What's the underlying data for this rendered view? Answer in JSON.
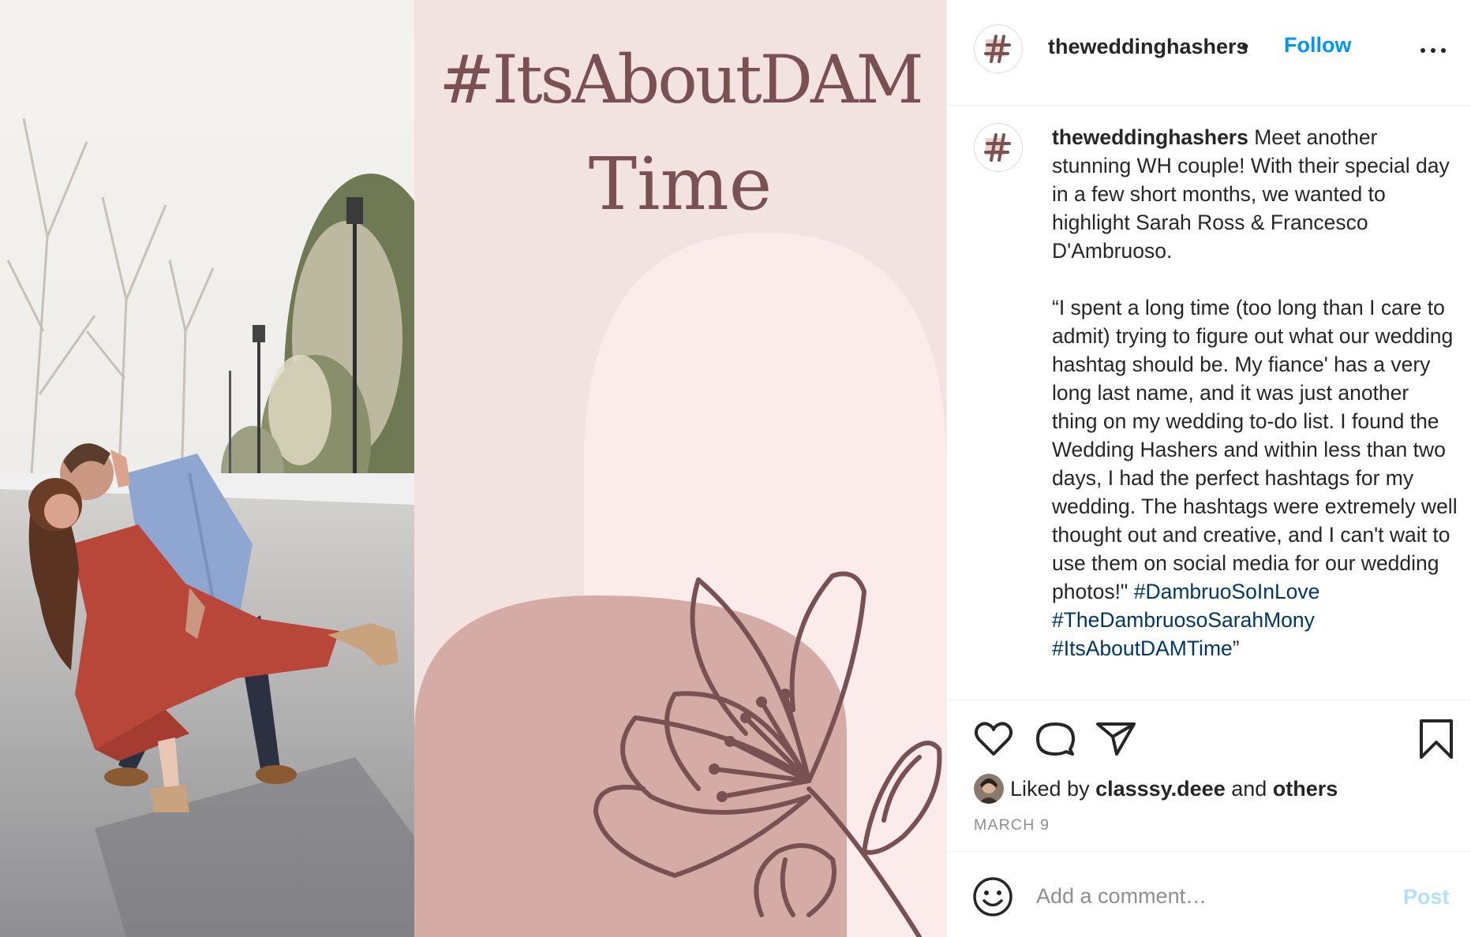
{
  "graphic": {
    "title_line1": "#ItsAboutDAM",
    "title_line2": "Time"
  },
  "colors": {
    "graphic_bg": "#f2e2e0",
    "arch_light": "#fbeceb",
    "arch_dark": "#d4aca5",
    "line_art": "#7a5153",
    "link_blue": "#0095f6",
    "hashtag_blue": "#00376b"
  },
  "header": {
    "username": "theweddinghashers",
    "separator": "•",
    "follow_label": "Follow",
    "avatar_glyph": "#",
    "more_icon": "more-horizontal-icon"
  },
  "caption": {
    "username": "theweddinghashers",
    "text": " Meet another stunning WH couple! With their special day in a few short months, we wanted to highlight Sarah Ross & Francesco D'Ambruoso.\n\n“I spent a long time (too long than I care to admit) trying to figure out what our wedding hashtag should be. My fiance' has a very long last name, and it was just another thing on my wedding to-do list. I found the Wedding Hashers and within less than two days, I had the perfect hashtags for my wedding. The hashtags were extremely well thought out and creative, and I can't wait to use them on social media for our wedding photos!\" ",
    "hashtag1": "#DambruoSoInLove",
    "hashtag2": "#TheDambruosoSarahMony",
    "hashtag3": "#ItsAboutDAMTime",
    "closing_quote": "”"
  },
  "actions": {
    "like_icon": "heart-icon",
    "comment_icon": "comment-bubble-icon",
    "share_icon": "paper-plane-icon",
    "save_icon": "bookmark-icon"
  },
  "likes": {
    "prefix": "Liked by ",
    "user": "classsy.deee",
    "middle": " and ",
    "others": "others"
  },
  "date": "MARCH 9",
  "comment_box": {
    "placeholder": "Add a comment…",
    "post_label": "Post",
    "emoji_icon": "smiley-icon"
  }
}
